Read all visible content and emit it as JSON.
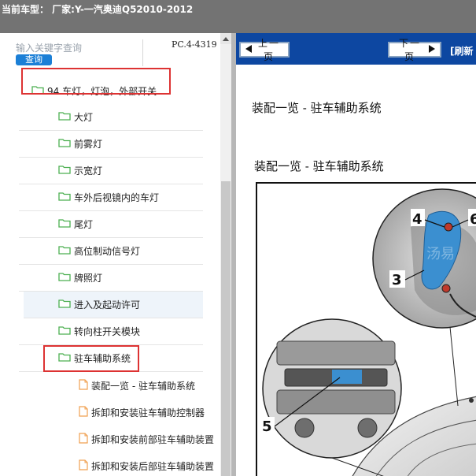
{
  "header": {
    "title": "当前车型：  厂家:Y-一汽奥迪Q52010-2012"
  },
  "sidebar": {
    "search": {
      "placeholder": "输入关键字查询",
      "button_label": "查询"
    },
    "code": "PC.4-4319",
    "tree": [
      {
        "label": "94 车灯，灯泡，外部开关",
        "icon": "folder-icon",
        "level": 0,
        "highlighted": true
      },
      {
        "label": "大灯",
        "icon": "folder-icon",
        "level": 1
      },
      {
        "label": "前雾灯",
        "icon": "folder-icon",
        "level": 1
      },
      {
        "label": "示宽灯",
        "icon": "folder-icon",
        "level": 1
      },
      {
        "label": "车外后视镜内的车灯",
        "icon": "folder-icon",
        "level": 1
      },
      {
        "label": "尾灯",
        "icon": "folder-icon",
        "level": 1
      },
      {
        "label": "高位制动信号灯",
        "icon": "folder-icon",
        "level": 1
      },
      {
        "label": "牌照灯",
        "icon": "folder-icon",
        "level": 1
      },
      {
        "label": "进入及起动许可",
        "icon": "folder-icon",
        "level": 1,
        "hover": true
      },
      {
        "label": "转向柱开关模块",
        "icon": "folder-icon",
        "level": 1
      },
      {
        "label": "驻车辅助系统",
        "icon": "folder-icon",
        "level": 1,
        "highlighted": true
      },
      {
        "label": "装配一览 - 驻车辅助系统",
        "icon": "document-icon",
        "level": 2
      },
      {
        "label": "拆卸和安装驻车辅助控制器",
        "icon": "document-icon",
        "level": 2
      },
      {
        "label": "拆卸和安装前部驻车辅助装置",
        "icon": "document-icon",
        "level": 2
      },
      {
        "label": "拆卸和安装后部驻车辅助装置",
        "icon": "document-icon",
        "level": 2
      }
    ]
  },
  "content": {
    "nav": {
      "prev_label": "上一页",
      "next_label": "下一页",
      "refresh_label": "[刷新"
    },
    "doc_title": "装配一览 - 驻车辅助系统",
    "doc_subtitle": "装配一览 - 驻车辅助系统",
    "figure": {
      "callouts": [
        "3",
        "4",
        "5",
        "6"
      ],
      "watermark": "汤易"
    }
  },
  "colors": {
    "titlebar": "#737373",
    "nav_bar": "#0d47a1",
    "search_button": "#1b7fd6",
    "highlight_box": "#dd3333",
    "folder_icon": "#4caf50",
    "document_icon": "#f0a050"
  }
}
